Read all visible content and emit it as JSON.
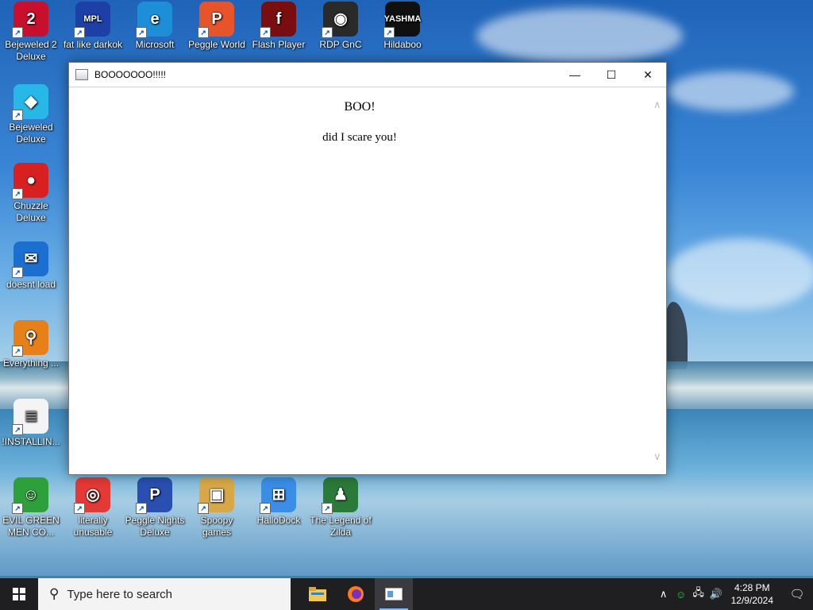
{
  "desktop": {
    "icons": [
      {
        "label": "Bejeweled 2 Deluxe",
        "glyph": "2",
        "color": "#c8102e"
      },
      {
        "label": "fat like darkok",
        "glyph": "MPL",
        "color": "#1c3fa8"
      },
      {
        "label": "Microsoft",
        "glyph": "e",
        "color": "#1c8fd8"
      },
      {
        "label": "Peggle World",
        "glyph": "P",
        "color": "#e8542a"
      },
      {
        "label": "Flash Player",
        "glyph": "f",
        "color": "#7a0d0d"
      },
      {
        "label": "RDP GnC",
        "glyph": "◉",
        "color": "#2a2a2a"
      },
      {
        "label": "Hildaboo",
        "glyph": "YASHMA",
        "color": "#101010"
      },
      {
        "label": "Bejeweled Deluxe",
        "glyph": "◆",
        "color": "#27b8e8"
      },
      {
        "label": "Chuzzle Deluxe",
        "glyph": "●",
        "color": "#d82020"
      },
      {
        "label": "doesnt load",
        "glyph": "✉",
        "color": "#1a6fd0"
      },
      {
        "label": "Everything ...",
        "glyph": "⚲",
        "color": "#e8801a"
      },
      {
        "label": "!INSTALLIN...",
        "glyph": "≣",
        "color": "#f4f4f4"
      },
      {
        "label": "EVIL GREEN MEN CO...",
        "glyph": "☺",
        "color": "#2ea03a"
      },
      {
        "label": "literally unusable",
        "glyph": "◎",
        "color": "#e53935"
      },
      {
        "label": "Peggle Nights Deluxe",
        "glyph": "P",
        "color": "#2a4fb0"
      },
      {
        "label": "Spoopy games",
        "glyph": "▣",
        "color": "#d8a848"
      },
      {
        "label": "HalloDock",
        "glyph": "⊞",
        "color": "#3a8ee8"
      },
      {
        "label": "The Legend of Zilda",
        "glyph": "♟",
        "color": "#2a7a3a"
      }
    ]
  },
  "window": {
    "title": "BOOOOOOO!!!!!",
    "minimize": "—",
    "maximize": "☐",
    "close": "✕",
    "heading": "BOO!",
    "text": "did I scare you!"
  },
  "taskbar": {
    "search_placeholder": "Type here to search",
    "time": "4:28 PM",
    "date": "12/9/2024",
    "tray": {
      "chevron": "∧",
      "network": "🖧",
      "volume": "🔊",
      "notifications": "🗨"
    }
  }
}
